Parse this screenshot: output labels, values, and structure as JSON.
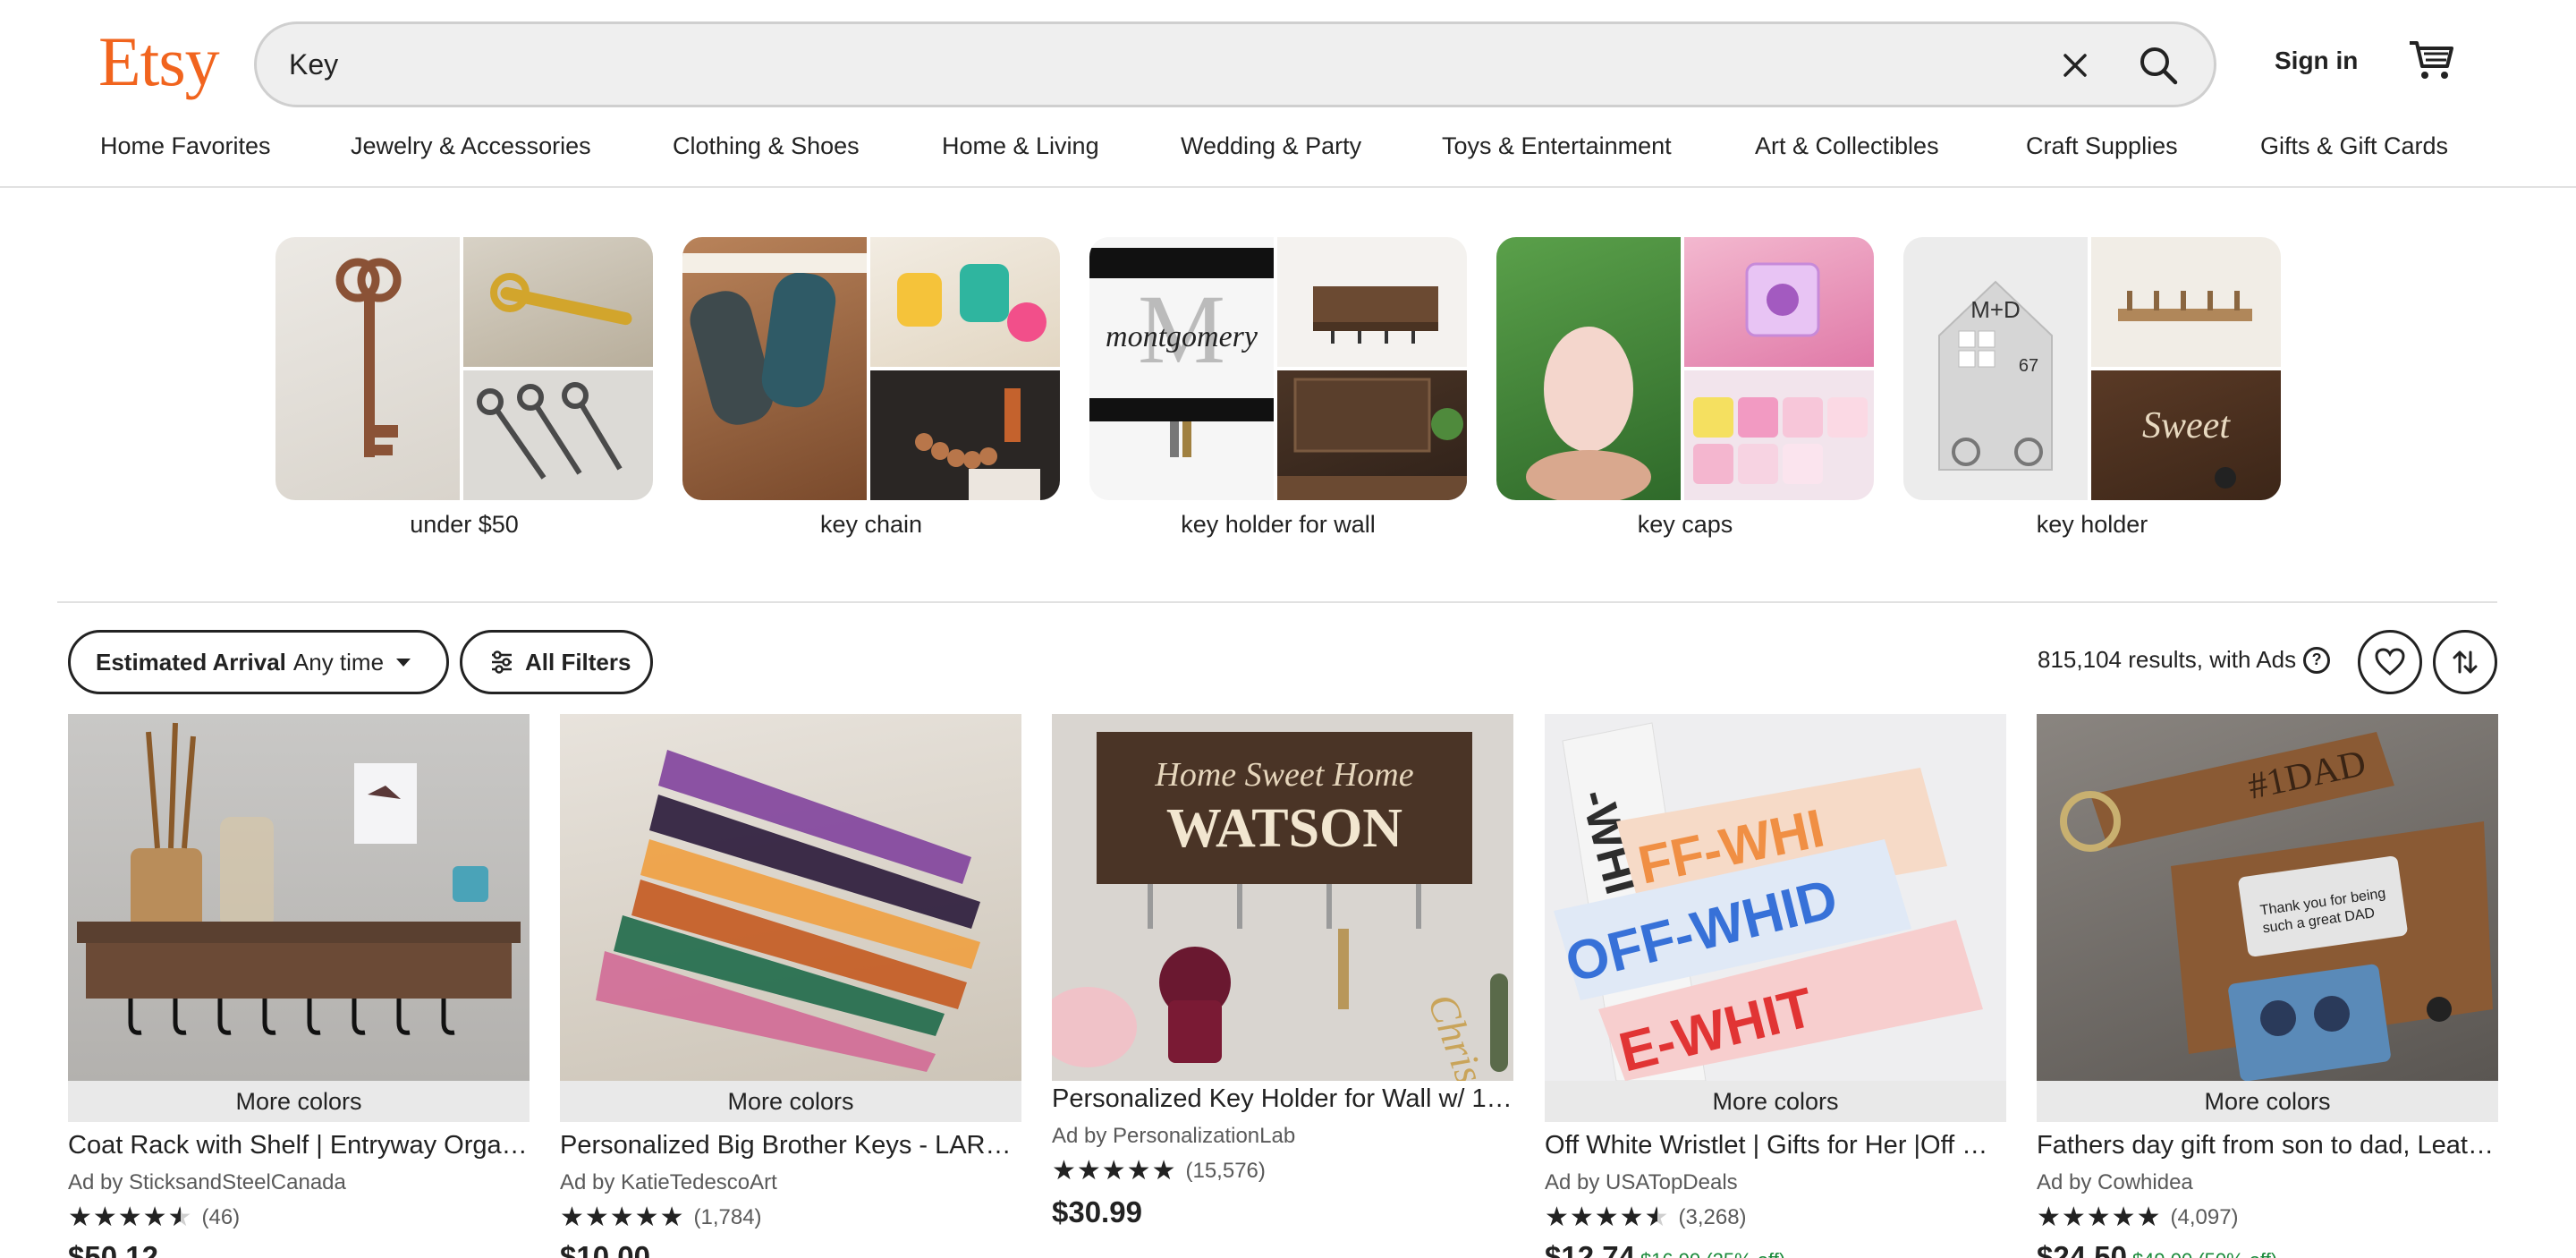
{
  "header": {
    "logo": "Etsy",
    "search_value": "Key",
    "sign_in": "Sign in",
    "brand_color": "#f1641e"
  },
  "nav": [
    "Home Favorites",
    "Jewelry & Accessories",
    "Clothing & Shoes",
    "Home & Living",
    "Wedding & Party",
    "Toys & Entertainment",
    "Art & Collectibles",
    "Craft Supplies",
    "Gifts & Gift Cards"
  ],
  "categories": [
    {
      "label": "under $50"
    },
    {
      "label": "key chain"
    },
    {
      "label": "key holder for wall"
    },
    {
      "label": "key caps"
    },
    {
      "label": "key holder"
    }
  ],
  "filters": {
    "arrival_label": "Estimated Arrival",
    "arrival_value": "Any time",
    "all_filters": "All Filters",
    "results_count": "815,104 results,",
    "results_suffix": "with Ads",
    "help": "?"
  },
  "listings": [
    {
      "more": "More colors",
      "title": "Coat Rack with Shelf | Entryway Organizer | Key Holder",
      "ad": "Ad by SticksandSteelCanada",
      "rating": 4.5,
      "reviews": "(46)",
      "price": "$50.12",
      "original": ""
    },
    {
      "more": "More colors",
      "title": "Personalized Big Brother Keys - LARGE",
      "ad": "Ad by KatieTedescoArt",
      "rating": 5,
      "reviews": "(1,784)",
      "price": "$10.00",
      "original": ""
    },
    {
      "more": "",
      "title": "Personalized Key Holder for Wall w/ 1…",
      "ad": "Ad by PersonalizationLab",
      "rating": 5,
      "reviews": "(15,576)",
      "price": "$30.99",
      "original": ""
    },
    {
      "more": "More colors",
      "title": "Off White Wristlet | Gifts for Her |Off White Keychain",
      "ad": "Ad by USATopDeals",
      "rating": 4.5,
      "reviews": "(3,268)",
      "price": "$12.74",
      "original": "$16.99 (25% off)"
    },
    {
      "more": "More colors",
      "title": "Fathers day gift from son to dad, Leather Keychain",
      "ad": "Ad by Cowhidea",
      "rating": 5,
      "reviews": "(4,097)",
      "price": "$24.50",
      "original": "$49.00 (50% off)"
    }
  ],
  "stars": "★★★★★"
}
